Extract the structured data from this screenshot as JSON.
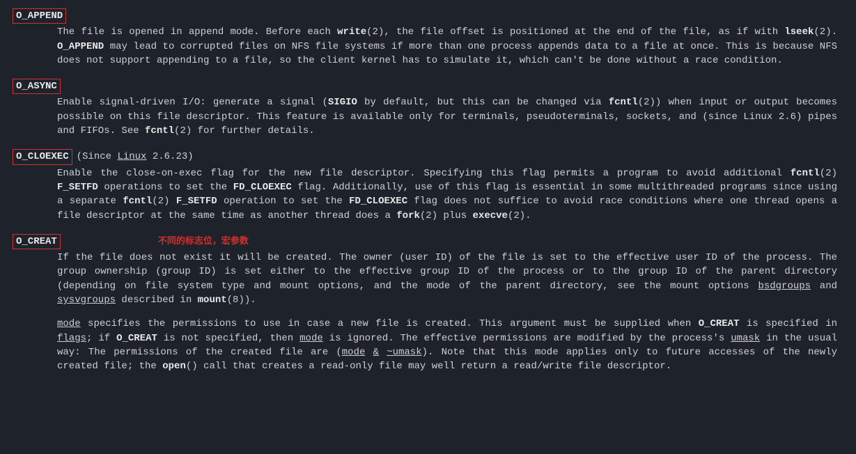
{
  "annotation": "不同的标志位，宏参数",
  "flags": {
    "append": {
      "name": "O_APPEND",
      "desc": "The file is opened in append mode.  Before each <b>write</b>(2), the file offset is positioned at the end of the file, as  if  with <b>lseek</b>(2).  <b>O_APPEND</b> may lead to corrupted files on NFS file systems if more than one process appends data to a file at once. This is because NFS does not support appending to a file, so the client kernel has to simulate it, which can't be done without a race condition."
    },
    "async": {
      "name": "O_ASYNC",
      "desc": "Enable  signal-driven  I/O:  generate a signal (<b>SIGIO</b> by default, but this can be changed via <b>fcntl</b>(2)) when input or output becomes possible on this file descriptor.  This feature is available  only  for  terminals,  pseudoterminals,  sockets,  and (since Linux 2.6) pipes and FIFOs.  See <b>fcntl</b>(2) for further details."
    },
    "cloexec": {
      "name": "O_CLOEXEC",
      "since": "(Since <u>Linux</u> 2.6.23)",
      "desc": "Enable  the  close-on-exec  flag  for  the  new file descriptor.  Specifying this flag permits a program to avoid additional <b>fcntl</b>(2) <b>F_SETFD</b> operations to set the <b>FD_CLOEXEC</b> flag.  Additionally, use of this flag is essential in  some  multithreaded programs  since using a separate <b>fcntl</b>(2) <b>F_SETFD</b> operation to set the <b>FD_CLOEXEC</b> flag does not suffice to avoid race conditions where one thread opens a file descriptor at the same time as another thread does a <b>fork</b>(2) plus <b>execve</b>(2)."
    },
    "creat": {
      "name": "O_CREAT",
      "p1": "If the file does not exist it will be created.  The owner (user ID) of the file is set to  the  effective  user  ID  of  the process.   The  group  ownership (group ID) is set either to the effective group ID of the process or to the group ID of the parent directory (depending on file system type and mount options, and the mode of  the  parent  directory,  see  the  mount options <u>bsdgroups</u> and <u>sysvgroups</u> described in <b>mount</b>(8)).",
      "p2": "<u>mode</u>  specifies the permissions to use in case a new file is created.  This argument must be supplied when <b>O_CREAT</b> is specified in <u>flags</u>; if <b>O_CREAT</b> is not specified, then <u>mode</u> is ignored.  The effective permissions are modified by  the  process's <u>umask</u> in the usual way: The permissions of the created file are (<u>mode</u> <u>&</u> <u>~umask</u>).  Note that this mode applies only to future accesses of the newly created file; the <b>open</b>() call that creates a read-only file may well return a read/write file descriptor."
    }
  }
}
